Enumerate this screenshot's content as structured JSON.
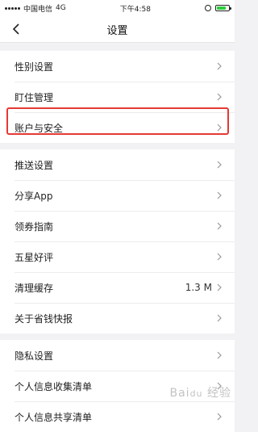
{
  "status_bar": {
    "carrier": "中国电信",
    "network": "4G",
    "time": "下午4:58",
    "battery_level": 0.8
  },
  "nav": {
    "back_icon": "chevron-left-icon",
    "title": "设置"
  },
  "groups": [
    {
      "items": [
        {
          "label": "性别设置",
          "value": ""
        },
        {
          "label": "盯住管理",
          "value": ""
        },
        {
          "label": "账户与安全",
          "value": "",
          "highlighted": true
        }
      ]
    },
    {
      "items": [
        {
          "label": "推送设置",
          "value": ""
        },
        {
          "label": "分享App",
          "value": ""
        },
        {
          "label": "领券指南",
          "value": ""
        },
        {
          "label": "五星好评",
          "value": ""
        },
        {
          "label": "清理缓存",
          "value": "1.3 M"
        },
        {
          "label": "关于省钱快报",
          "value": ""
        }
      ]
    },
    {
      "items": [
        {
          "label": "隐私设置",
          "value": ""
        },
        {
          "label": "个人信息收集清单",
          "value": ""
        },
        {
          "label": "个人信息共享清单",
          "value": ""
        }
      ]
    }
  ],
  "highlight_color": "#e53935",
  "watermark": "Baidu 经验"
}
